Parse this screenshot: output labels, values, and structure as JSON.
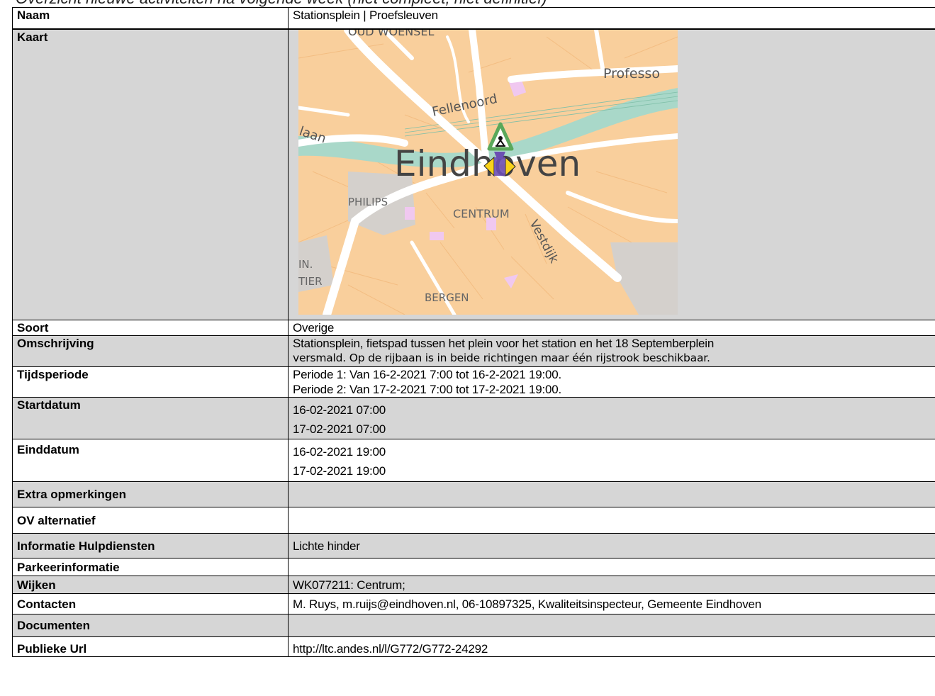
{
  "heading": "Overzicht nieuwe activiteiten na volgende week (niet compleet, niet definitief)",
  "rows": {
    "naam": {
      "label": "Naam",
      "value": "Stationsplein | Proefsleuven"
    },
    "kaart": {
      "label": "Kaart"
    },
    "soort": {
      "label": "Soort",
      "value": "Overige"
    },
    "omschrijving": {
      "label": "Omschrijving",
      "line1": "Stationsplein, fietspad tussen het plein voor het station en het 18 Septemberplein",
      "line2": "versmald. Op de rijbaan is in beide richtingen maar één rijstrook beschikbaar."
    },
    "tijdsperiode": {
      "label": "Tijdsperiode",
      "line1": "Periode 1: Van 16-2-2021 7:00 tot 16-2-2021 19:00.",
      "line2": "Periode 2: Van 17-2-2021 7:00 tot 17-2-2021 19:00."
    },
    "startdatum": {
      "label": "Startdatum",
      "line1": "16-02-2021 07:00",
      "line2": "17-02-2021 07:00"
    },
    "einddatum": {
      "label": "Einddatum",
      "line1": "16-02-2021 19:00",
      "line2": "17-02-2021 19:00"
    },
    "extra": {
      "label": "Extra opmerkingen",
      "value": ""
    },
    "ov": {
      "label": "OV alternatief",
      "value": ""
    },
    "hulpdiensten": {
      "label": "Informatie Hulpdiensten",
      "value": "Lichte hinder"
    },
    "parkeer": {
      "label": "Parkeerinformatie",
      "value": ""
    },
    "wijken": {
      "label": "Wijken",
      "value": "WK077211: Centrum;"
    },
    "contacten": {
      "label": "Contacten",
      "value": "M. Ruys, m.ruijs@eindhoven.nl, 06-10897325, Kwaliteitsinspecteur, Gemeente Eindhoven"
    },
    "documenten": {
      "label": "Documenten",
      "value": ""
    },
    "url": {
      "label": "Publieke Url",
      "value": "http://ltc.andes.nl/l/G772/G772-24292"
    }
  },
  "map": {
    "labels": {
      "top": "OUD WOENSEL",
      "professor": "Professo",
      "fellenoord": "Fellenoord",
      "laan": "laan",
      "city": "Eindhoven",
      "philips": "PHILIPS",
      "centrum": "CENTRUM",
      "vestdijk": "Vestdijk",
      "in": "IN.",
      "tier": "TIER",
      "bergen": "BERGEN"
    },
    "colors": {
      "land": "#f9cf9c",
      "road": "#ffffff",
      "rail": "#a9d8c9",
      "grey_block": "#d4d0cc",
      "pink_block": "#f0c8f0"
    },
    "icons": [
      "roadworks-icon",
      "warning-triangle-icon"
    ]
  }
}
